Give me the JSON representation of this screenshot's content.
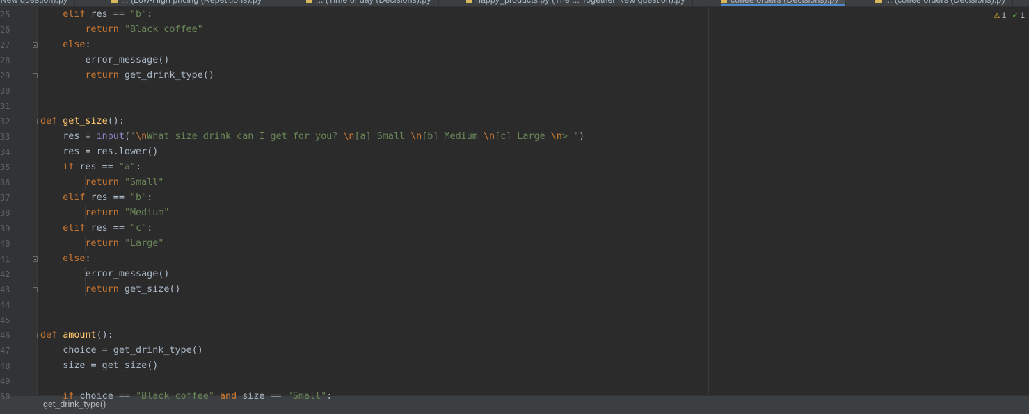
{
  "tabs": [
    {
      "label": "...ch: New question).py",
      "active": false
    },
    {
      "label": "... (Low-High pricing (Repetitions).py",
      "active": false
    },
    {
      "label": "... (Time of day (Decisions).py",
      "active": false
    },
    {
      "label": "happy_products.py (The ... Together New question).py",
      "active": false
    },
    {
      "label": "coffee orders (Decisions).py",
      "active": true
    },
    {
      "label": "... (coffee orders (Decisions).py",
      "active": false
    }
  ],
  "inspections": {
    "warnings": "1",
    "ok": "1"
  },
  "code_lines": [
    {
      "num": "25",
      "tokens": [
        [
          "",
          "    "
        ],
        [
          "k",
          "elif"
        ],
        [
          "",
          " res == "
        ],
        [
          "s",
          "\"b\""
        ],
        [
          "",
          ":"
        ]
      ]
    },
    {
      "num": "26",
      "tokens": [
        [
          "",
          "        "
        ],
        [
          "k",
          "return"
        ],
        [
          "",
          " "
        ],
        [
          "s",
          "\"Black coffee\""
        ]
      ]
    },
    {
      "num": "27",
      "tokens": [
        [
          "",
          "    "
        ],
        [
          "k",
          "else"
        ],
        [
          "",
          ":"
        ]
      ]
    },
    {
      "num": "28",
      "tokens": [
        [
          "",
          "        error_message()"
        ]
      ]
    },
    {
      "num": "29",
      "tokens": [
        [
          "",
          "        "
        ],
        [
          "k",
          "return"
        ],
        [
          "",
          " get_drink_type()"
        ]
      ]
    },
    {
      "num": "30",
      "tokens": []
    },
    {
      "num": "31",
      "tokens": []
    },
    {
      "num": "32",
      "tokens": [
        [
          "k",
          "def"
        ],
        [
          "",
          " "
        ],
        [
          "f",
          "get_size"
        ],
        [
          "",
          "():"
        ]
      ]
    },
    {
      "num": "33",
      "tokens": [
        [
          "",
          "    res = "
        ],
        [
          "b",
          "input"
        ],
        [
          "",
          "("
        ],
        [
          "s",
          "'"
        ],
        [
          "e",
          "\\n"
        ],
        [
          "s",
          "What size drink can I get for you? "
        ],
        [
          "e",
          "\\n"
        ],
        [
          "s",
          "[a] Small "
        ],
        [
          "e",
          "\\n"
        ],
        [
          "s",
          "[b] Medium "
        ],
        [
          "e",
          "\\n"
        ],
        [
          "s",
          "[c] Large "
        ],
        [
          "e",
          "\\n"
        ],
        [
          "s",
          "> '"
        ],
        [
          "",
          ")"
        ]
      ]
    },
    {
      "num": "34",
      "tokens": [
        [
          "",
          "    res = res.lower()"
        ]
      ]
    },
    {
      "num": "35",
      "tokens": [
        [
          "",
          "    "
        ],
        [
          "k",
          "if"
        ],
        [
          "",
          " res == "
        ],
        [
          "s",
          "\"a\""
        ],
        [
          "",
          ":"
        ]
      ]
    },
    {
      "num": "36",
      "tokens": [
        [
          "",
          "        "
        ],
        [
          "k",
          "return"
        ],
        [
          "",
          " "
        ],
        [
          "s",
          "\"Small\""
        ]
      ]
    },
    {
      "num": "37",
      "tokens": [
        [
          "",
          "    "
        ],
        [
          "k",
          "elif"
        ],
        [
          "",
          " res == "
        ],
        [
          "s",
          "\"b\""
        ],
        [
          "",
          ":"
        ]
      ]
    },
    {
      "num": "38",
      "tokens": [
        [
          "",
          "        "
        ],
        [
          "k",
          "return"
        ],
        [
          "",
          " "
        ],
        [
          "s",
          "\"Medium\""
        ]
      ]
    },
    {
      "num": "39",
      "tokens": [
        [
          "",
          "    "
        ],
        [
          "k",
          "elif"
        ],
        [
          "",
          " res == "
        ],
        [
          "s",
          "\"c\""
        ],
        [
          "",
          ":"
        ]
      ]
    },
    {
      "num": "40",
      "tokens": [
        [
          "",
          "        "
        ],
        [
          "k",
          "return"
        ],
        [
          "",
          " "
        ],
        [
          "s",
          "\"Large\""
        ]
      ]
    },
    {
      "num": "41",
      "tokens": [
        [
          "",
          "    "
        ],
        [
          "k",
          "else"
        ],
        [
          "",
          ":"
        ]
      ]
    },
    {
      "num": "42",
      "tokens": [
        [
          "",
          "        error_message()"
        ]
      ]
    },
    {
      "num": "43",
      "tokens": [
        [
          "",
          "        "
        ],
        [
          "k",
          "return"
        ],
        [
          "",
          " get_size()"
        ]
      ]
    },
    {
      "num": "44",
      "tokens": []
    },
    {
      "num": "45",
      "tokens": []
    },
    {
      "num": "46",
      "tokens": [
        [
          "k",
          "def"
        ],
        [
          "",
          " "
        ],
        [
          "f",
          "amount"
        ],
        [
          "",
          "():"
        ]
      ]
    },
    {
      "num": "47",
      "tokens": [
        [
          "",
          "    choice = get_drink_type()"
        ]
      ]
    },
    {
      "num": "48",
      "tokens": [
        [
          "",
          "    size = get_size()"
        ]
      ]
    },
    {
      "num": "49",
      "tokens": []
    },
    {
      "num": "50",
      "tokens": [
        [
          "",
          "    "
        ],
        [
          "k",
          "if"
        ],
        [
          "",
          " choice == "
        ],
        [
          "s",
          "\"Black coffee\""
        ],
        [
          "",
          " "
        ],
        [
          "k",
          "and"
        ],
        [
          "",
          " size == "
        ],
        [
          "s",
          "\"Small\""
        ],
        [
          "",
          ":"
        ]
      ]
    }
  ],
  "status": {
    "breadcrumb": "get_drink_type()"
  }
}
